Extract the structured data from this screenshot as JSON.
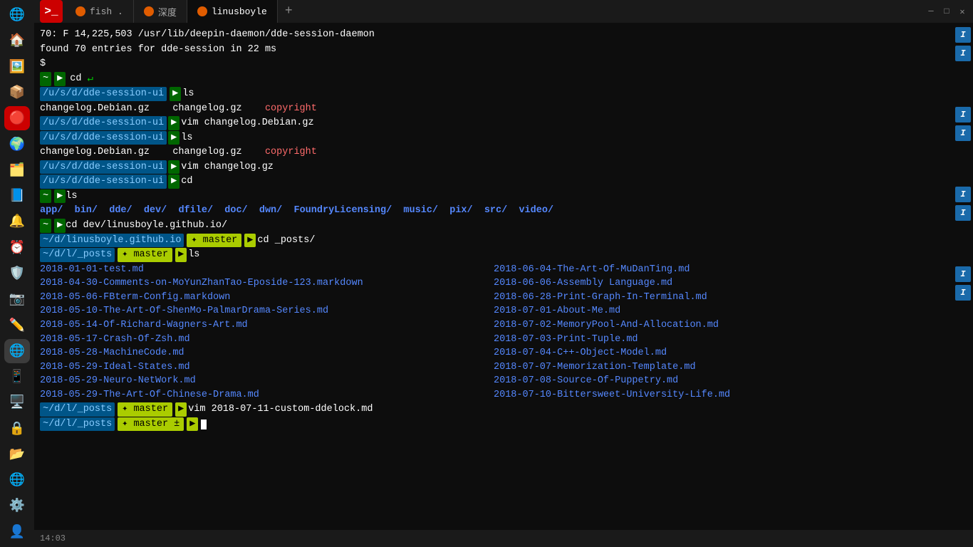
{
  "window": {
    "title": "fish . — 深度 — linusboyle",
    "tabs": [
      {
        "label": "fish .",
        "active": false
      },
      {
        "label": "深度",
        "active": false
      },
      {
        "label": "linusboyle",
        "active": true
      }
    ]
  },
  "sidebar": {
    "icons": [
      "🌐",
      "🏠",
      "🖼️",
      "📦",
      "🔴",
      "🌍",
      "🗂️",
      "📘",
      "🔔",
      "⏰",
      "🛡️",
      "📷",
      "✏️",
      "🌐",
      "📱",
      "🖥️",
      "🔒",
      "📂",
      "🌐",
      "⚙️",
      "👤"
    ]
  },
  "terminal": {
    "lines": [
      {
        "type": "output",
        "text": "    70: F 14,225,503 /usr/lib/deepin-daemon/dde-session-daemon"
      },
      {
        "type": "output",
        "text": "    found 70 entries for dde-session in 22 ms"
      },
      {
        "type": "prompt_simple",
        "text": "$"
      },
      {
        "type": "prompt_cmd",
        "tilde": "~",
        "cmd": "cd",
        "icon": "↵"
      },
      {
        "type": "prompt_ls",
        "path": "/u/s/d/dde-session-ui",
        "arrow": "▶",
        "cmd": "ls"
      },
      {
        "type": "ls_output_1",
        "files": [
          "changelog.Debian.gz",
          "changelog.gz",
          "copyright"
        ]
      },
      {
        "type": "prompt_vim",
        "path": "/u/s/d/dde-session-ui",
        "arrow": "▶",
        "cmd": "vim changelog.Debian.gz"
      },
      {
        "type": "prompt_ls2",
        "path": "/u/s/d/dde-session-ui",
        "arrow": "▶",
        "cmd": "ls"
      },
      {
        "type": "ls_output_2",
        "files": [
          "changelog.Debian.gz",
          "changelog.gz",
          "copyright"
        ]
      },
      {
        "type": "prompt_vim2",
        "path": "/u/s/d/dde-session-ui",
        "arrow": "▶",
        "cmd": "vim changelog.gz"
      },
      {
        "type": "prompt_cd2",
        "path": "/u/s/d/dde-session-ui",
        "arrow": "▶",
        "cmd": "cd"
      },
      {
        "type": "prompt_ls3",
        "tilde": "~",
        "cmd": "ls"
      },
      {
        "type": "dir_listing",
        "items": [
          "app/",
          "bin/",
          "dde/",
          "dev/",
          "dfile/",
          "doc/",
          "dwn/",
          "FoundryLicensing/",
          "music/",
          "pix/",
          "src/",
          "video/"
        ]
      },
      {
        "type": "prompt_cd3",
        "tilde": "~",
        "cmd": "cd dev/linusboyle.github.io/"
      },
      {
        "type": "prompt_master1",
        "path": "~/d/linusboyle.github.io",
        "branch": "master",
        "arrow": "▶",
        "cmd": "cd _posts/"
      },
      {
        "type": "prompt_master2",
        "path": "~/d/l/_posts",
        "branch": "master",
        "arrow": "▶",
        "cmd": "ls"
      },
      {
        "type": "file_list_row1",
        "left": "2018-01-01-test.md",
        "right": "2018-06-04-The-Art-Of-MuDanTing.md"
      },
      {
        "type": "file_list_row2",
        "left": "2018-04-30-Comments-on-MoYunZhanTao-Eposide-123.markdown",
        "right": "2018-06-06-Assembly Language.md"
      },
      {
        "type": "file_list_row3",
        "left": "2018-05-06-FBterm-Config.markdown",
        "right": "2018-06-28-Print-Graph-In-Terminal.md"
      },
      {
        "type": "file_list_row4",
        "left": "2018-05-10-The-Art-Of-ShenMo-PalmarDrama-Series.md",
        "right": "2018-07-01-About-Me.md"
      },
      {
        "type": "file_list_row5",
        "left": "2018-05-14-Of-Richard-Wagners-Art.md",
        "right": "2018-07-02-MemoryPool-And-Allocation.md"
      },
      {
        "type": "file_list_row6",
        "left": "2018-05-17-Crash-Of-Zsh.md",
        "right": "2018-07-03-Print-Tuple.md"
      },
      {
        "type": "file_list_row7",
        "left": "2018-05-28-MachineCode.md",
        "right": "2018-07-04-C++-Object-Model.md"
      },
      {
        "type": "file_list_row8",
        "left": "2018-05-29-Ideal-States.md",
        "right": "2018-07-07-Memorization-Template.md"
      },
      {
        "type": "file_list_row9",
        "left": "2018-05-29-Neuro-NetWork.md",
        "right": "2018-07-08-Source-Of-Puppetry.md"
      },
      {
        "type": "file_list_row10",
        "left": "2018-05-29-The-Art-Of-Chinese-Drama.md",
        "right": "2018-07-10-Bittersweet-University-Life.md"
      },
      {
        "type": "prompt_vim3",
        "path": "~/d/l/_posts",
        "branch": "master",
        "arrow": "▶",
        "cmd": "vim 2018-07-11-custom-ddelock.md"
      },
      {
        "type": "prompt_final",
        "path": "~/d/l/_posts",
        "branch": "master ±",
        "cursor": true
      }
    ]
  },
  "statusbar": {
    "time": "14:03"
  },
  "colors": {
    "accent_blue": "#1a6aaa",
    "prompt_green": "#006600",
    "prompt_path_bg": "#0055aa",
    "prompt_branch_bg": "#aacc00",
    "copyright_color": "#ff6b6b",
    "dir_color": "#5588ff"
  }
}
